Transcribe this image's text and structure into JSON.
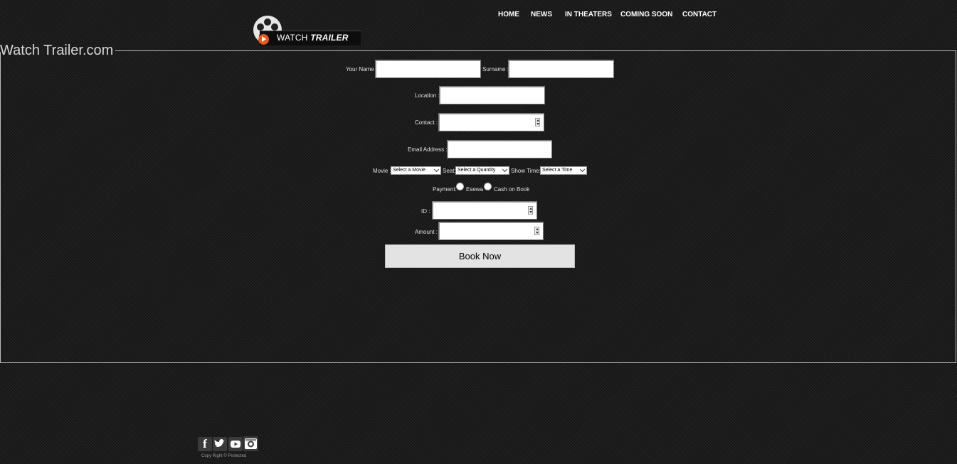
{
  "header": {
    "logo": {
      "prefix": "WATCH",
      "emphasis": "TRAILER"
    },
    "nav": [
      "HOME",
      "NEWS",
      "IN THEATERS",
      "COMING SOON",
      "CONTACT"
    ]
  },
  "form": {
    "legend": "Watch Trailer.com",
    "your_name_label": "Your Name :",
    "surname_label": "Surname :",
    "location_label": "Location :",
    "contact_label": "Contact :",
    "email_label": "Email Address :",
    "movie_label": "Movie :",
    "movie_select": "Select a Movie",
    "seat_label": "Seat:",
    "seat_select": "Select a Quantity",
    "showtime_label": "Show Time:",
    "showtime_select": "Select a Time",
    "payment_label": "Payment:",
    "payment_options": [
      "Esewa",
      "Cash on Book"
    ],
    "id_label": "ID :",
    "amount_label": "Amount :",
    "submit_label": "Book Now"
  },
  "footer": {
    "social_icons": [
      "facebook-icon",
      "twitter-icon",
      "youtube-icon",
      "instagram-icon"
    ],
    "copyright": "Copy Right © Protected"
  }
}
